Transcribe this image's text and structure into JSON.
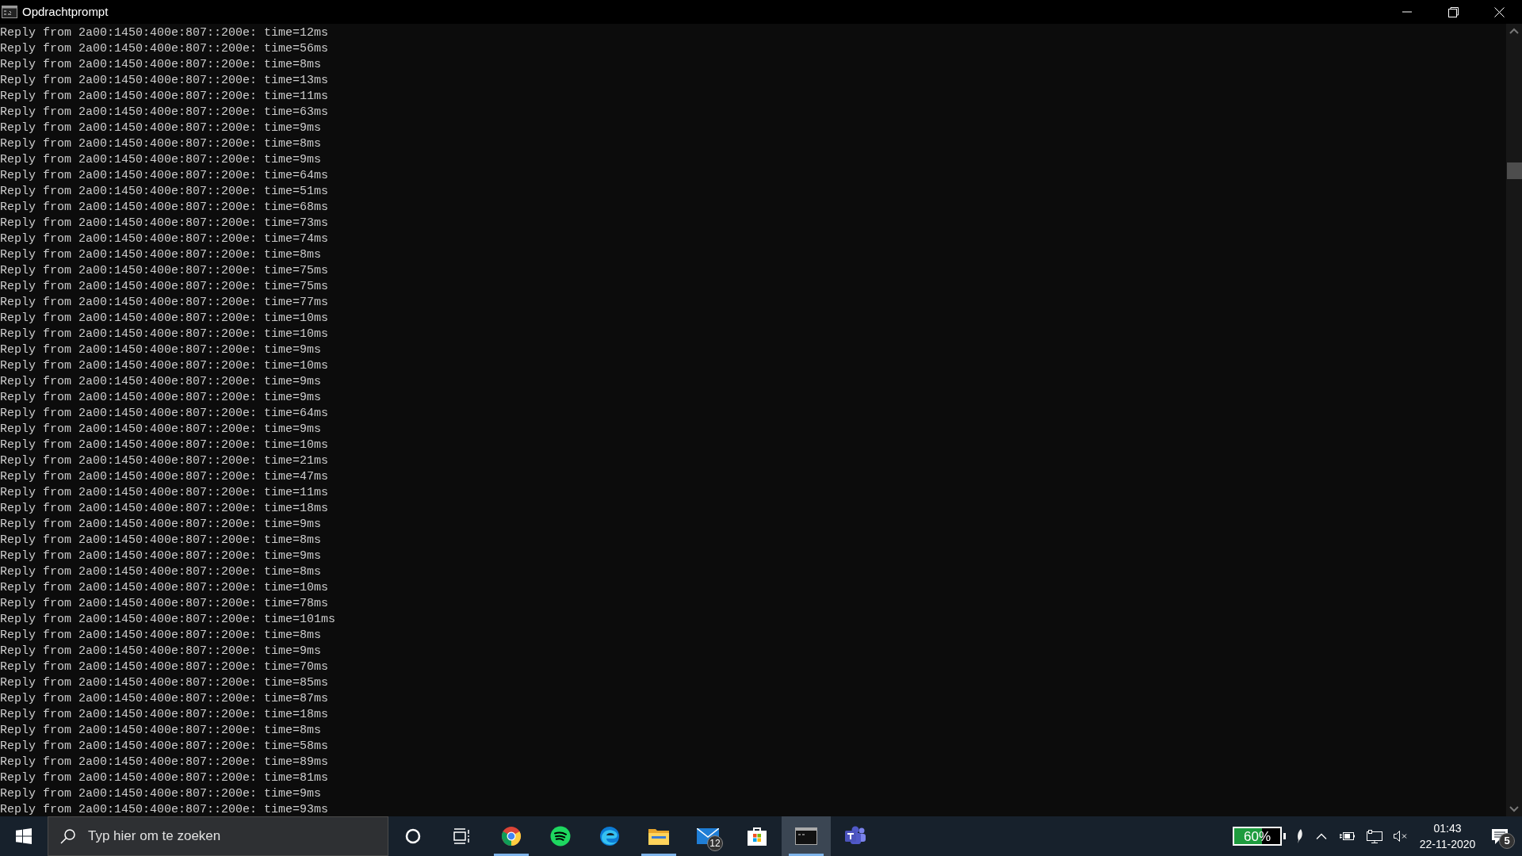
{
  "window": {
    "title": "Opdrachtprompt"
  },
  "console": {
    "lines": [
      "Reply from 2a00:1450:400e:807::200e: time=12ms",
      "Reply from 2a00:1450:400e:807::200e: time=56ms",
      "Reply from 2a00:1450:400e:807::200e: time=8ms",
      "Reply from 2a00:1450:400e:807::200e: time=13ms",
      "Reply from 2a00:1450:400e:807::200e: time=11ms",
      "Reply from 2a00:1450:400e:807::200e: time=63ms",
      "Reply from 2a00:1450:400e:807::200e: time=9ms",
      "Reply from 2a00:1450:400e:807::200e: time=8ms",
      "Reply from 2a00:1450:400e:807::200e: time=9ms",
      "Reply from 2a00:1450:400e:807::200e: time=64ms",
      "Reply from 2a00:1450:400e:807::200e: time=51ms",
      "Reply from 2a00:1450:400e:807::200e: time=68ms",
      "Reply from 2a00:1450:400e:807::200e: time=73ms",
      "Reply from 2a00:1450:400e:807::200e: time=74ms",
      "Reply from 2a00:1450:400e:807::200e: time=8ms",
      "Reply from 2a00:1450:400e:807::200e: time=75ms",
      "Reply from 2a00:1450:400e:807::200e: time=75ms",
      "Reply from 2a00:1450:400e:807::200e: time=77ms",
      "Reply from 2a00:1450:400e:807::200e: time=10ms",
      "Reply from 2a00:1450:400e:807::200e: time=10ms",
      "Reply from 2a00:1450:400e:807::200e: time=9ms",
      "Reply from 2a00:1450:400e:807::200e: time=10ms",
      "Reply from 2a00:1450:400e:807::200e: time=9ms",
      "Reply from 2a00:1450:400e:807::200e: time=9ms",
      "Reply from 2a00:1450:400e:807::200e: time=64ms",
      "Reply from 2a00:1450:400e:807::200e: time=9ms",
      "Reply from 2a00:1450:400e:807::200e: time=10ms",
      "Reply from 2a00:1450:400e:807::200e: time=21ms",
      "Reply from 2a00:1450:400e:807::200e: time=47ms",
      "Reply from 2a00:1450:400e:807::200e: time=11ms",
      "Reply from 2a00:1450:400e:807::200e: time=18ms",
      "Reply from 2a00:1450:400e:807::200e: time=9ms",
      "Reply from 2a00:1450:400e:807::200e: time=8ms",
      "Reply from 2a00:1450:400e:807::200e: time=9ms",
      "Reply from 2a00:1450:400e:807::200e: time=8ms",
      "Reply from 2a00:1450:400e:807::200e: time=10ms",
      "Reply from 2a00:1450:400e:807::200e: time=78ms",
      "Reply from 2a00:1450:400e:807::200e: time=101ms",
      "Reply from 2a00:1450:400e:807::200e: time=8ms",
      "Reply from 2a00:1450:400e:807::200e: time=9ms",
      "Reply from 2a00:1450:400e:807::200e: time=70ms",
      "Reply from 2a00:1450:400e:807::200e: time=85ms",
      "Reply from 2a00:1450:400e:807::200e: time=87ms",
      "Reply from 2a00:1450:400e:807::200e: time=18ms",
      "Reply from 2a00:1450:400e:807::200e: time=8ms",
      "Reply from 2a00:1450:400e:807::200e: time=58ms",
      "Reply from 2a00:1450:400e:807::200e: time=89ms",
      "Reply from 2a00:1450:400e:807::200e: time=81ms",
      "Reply from 2a00:1450:400e:807::200e: time=9ms",
      "Reply from 2a00:1450:400e:807::200e: time=93ms"
    ]
  },
  "taskbar": {
    "search": {
      "placeholder": "Typ hier om te zoeken"
    },
    "buttons": [
      {
        "kind": "cortana",
        "running": false,
        "selected": false
      },
      {
        "kind": "taskview",
        "running": false,
        "selected": false
      },
      {
        "kind": "chrome",
        "running": true,
        "selected": false
      },
      {
        "kind": "spotify",
        "running": false,
        "selected": false
      },
      {
        "kind": "edge",
        "running": false,
        "selected": false
      },
      {
        "kind": "explorer",
        "running": true,
        "selected": false
      },
      {
        "kind": "mail",
        "running": false,
        "selected": false,
        "badge": "12"
      },
      {
        "kind": "store",
        "running": false,
        "selected": false
      },
      {
        "kind": "terminal",
        "running": true,
        "selected": true
      },
      {
        "kind": "teams",
        "running": false,
        "selected": false
      }
    ],
    "tray": {
      "battery": {
        "reading": "60%",
        "level": 0.6
      },
      "speaker_muted": true,
      "time": "01:43",
      "date": "22-11-2020",
      "notifications": "5"
    }
  }
}
